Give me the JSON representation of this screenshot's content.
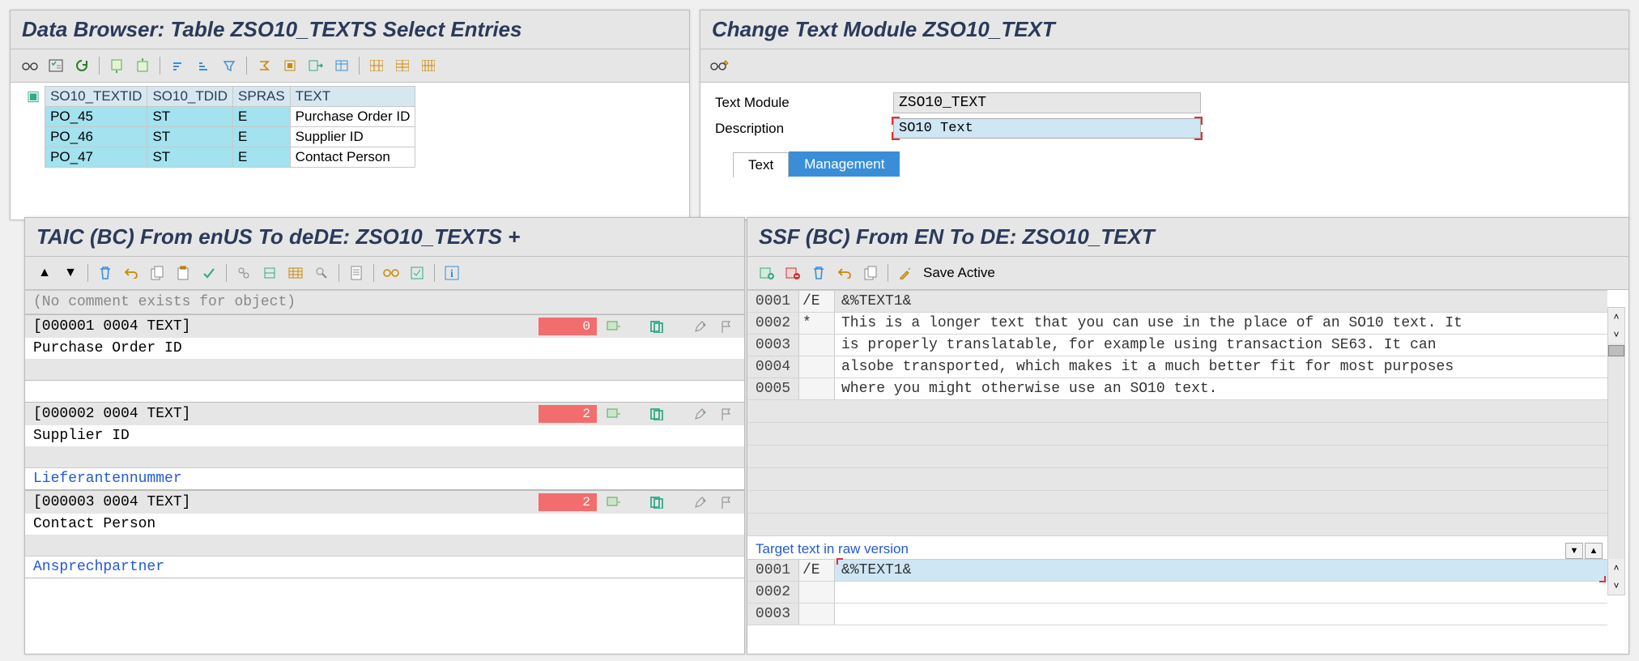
{
  "databrowser": {
    "title": "Data Browser: Table ZSO10_TEXTS Select Entries",
    "columns": [
      "SO10_TEXTID",
      "SO10_TDID",
      "SPRAS",
      "TEXT"
    ],
    "rows": [
      {
        "id": "PO_45",
        "tdid": "ST",
        "spras": "E",
        "text": "Purchase Order ID"
      },
      {
        "id": "PO_46",
        "tdid": "ST",
        "spras": "E",
        "text": "Supplier ID"
      },
      {
        "id": "PO_47",
        "tdid": "ST",
        "spras": "E",
        "text": "Contact Person"
      }
    ]
  },
  "change": {
    "title": "Change Text Module ZSO10_TEXT",
    "text_module_lbl": "Text Module",
    "text_module_val": "ZSO10_TEXT",
    "description_lbl": "Description",
    "description_val": "SO10 Text",
    "tabs": [
      {
        "label": "Text",
        "state": "active"
      },
      {
        "label": "Management",
        "state": "blue"
      }
    ]
  },
  "taic": {
    "title": "TAIC (BC) From enUS To deDE: ZSO10_TEXTS +",
    "comment": "(No comment exists for object)",
    "items": [
      {
        "code": "[000001 0004 TEXT]",
        "count": "0",
        "src": "Purchase Order ID",
        "trans": ""
      },
      {
        "code": "[000002 0004 TEXT]",
        "count": "2",
        "src": "Supplier ID",
        "trans": "Lieferantennummer"
      },
      {
        "code": "[000003 0004 TEXT]",
        "count": "2",
        "src": "Contact Person",
        "trans": "Ansprechpartner"
      }
    ]
  },
  "ssf": {
    "title": "SSF (BC) From EN To DE: ZSO10_TEXT",
    "save_label": "Save Active",
    "source": [
      {
        "ln": "0001",
        "mark": "/E",
        "txt": "&%TEXT1&"
      },
      {
        "ln": "0002",
        "mark": "*",
        "txt": "This is a longer text that you can use in the place of an SO10 text. It"
      },
      {
        "ln": "0003",
        "mark": "",
        "txt": "is properly translatable, for example using transaction SE63. It can"
      },
      {
        "ln": "0004",
        "mark": "",
        "txt": "alsobe transported, which makes it a much better fit for most purposes"
      },
      {
        "ln": "0005",
        "mark": "",
        "txt": "where you might otherwise use an SO10 text."
      }
    ],
    "target_label": "Target text in raw version",
    "target": [
      {
        "ln": "0001",
        "mark": "/E",
        "txt": "&%TEXT1&"
      },
      {
        "ln": "0002",
        "mark": "",
        "txt": ""
      },
      {
        "ln": "0003",
        "mark": "",
        "txt": ""
      }
    ]
  }
}
